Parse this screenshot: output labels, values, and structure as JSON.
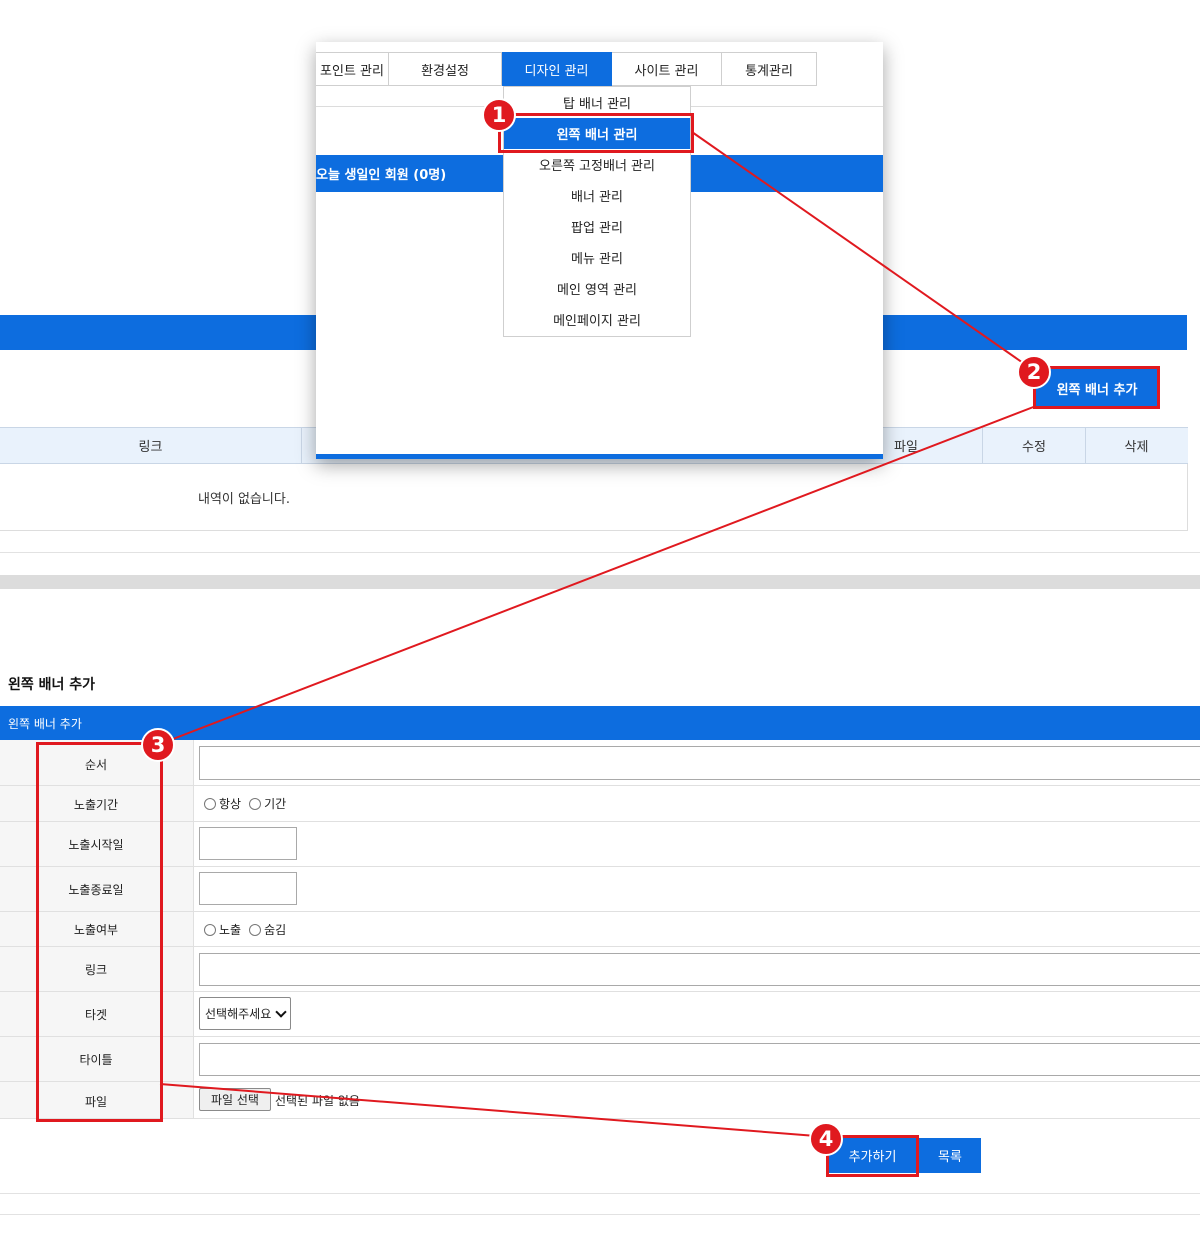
{
  "main_menu": {
    "tabs": [
      "포인트 관리",
      "환경설정",
      "디자인 관리",
      "사이트 관리",
      "통계관리"
    ],
    "active_tab": "디자인 관리"
  },
  "design_submenu": [
    "탑 배너 관리",
    "왼쪽 배너 관리",
    "오른쪽 고정배너 관리",
    "배너 관리",
    "팝업 관리",
    "메뉴 관리",
    "메인 영역 관리",
    "메인페이지 관리"
  ],
  "dashboard": {
    "birthday_title": "오늘 생일인 회원 (0명)"
  },
  "banner_list": {
    "add_button": "왼쪽 배너 추가",
    "columns": {
      "link": "링크",
      "file": "파일",
      "edit": "수정",
      "delete": "삭제"
    },
    "empty_message": "내역이 없습니다."
  },
  "form": {
    "page_title": "왼쪽 배너 추가",
    "section_title": "왼쪽 배너 추가",
    "labels": {
      "order": "순서",
      "period": "노출기간",
      "start": "노출시작일",
      "end": "노출종료일",
      "visible": "노출여부",
      "link": "링크",
      "target": "타겟",
      "title": "타이틀",
      "file": "파일"
    },
    "period_options": [
      "항상",
      "기간"
    ],
    "visible_options": [
      "노출",
      "숨김"
    ],
    "target_select": "선택해주세요",
    "file_button": "파일 선택",
    "file_status": "선택된 파일 없음",
    "submit_button": "추가하기",
    "list_button": "목록"
  },
  "annotations": [
    "1",
    "2",
    "3",
    "4"
  ],
  "colors": {
    "primary_blue": "#0d6ddf",
    "annotation_red": "#e0191f",
    "header_tint": "#e9f2fc"
  }
}
